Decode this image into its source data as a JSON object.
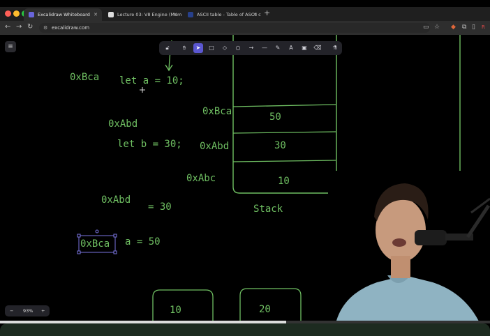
{
  "browser": {
    "tabs": [
      {
        "label": "Excalidraw Whiteboard",
        "active": true
      },
      {
        "label": "Lecture 03: V8 Engine (Mem",
        "active": false
      },
      {
        "label": "ASCII table - Table of ASCII c",
        "active": false
      }
    ],
    "url": "excalidraw.com",
    "profile_initial": "R"
  },
  "canvas": {
    "notes": {
      "addr_bca_top": "0xBca",
      "let_a": "let a = 10;",
      "addr_abd_1": "0xAbd",
      "let_b": "let b = 30;",
      "addr_abd_2": "0xAbd",
      "eq_30": "= 30",
      "addr_bca_selected": "0xBca",
      "a_eq_50": "a = 50"
    },
    "stack": {
      "label": "Stack",
      "cells": [
        {
          "addr": "0xBca",
          "value": "50"
        },
        {
          "addr": "0xAbd",
          "value": "30"
        },
        {
          "addr": "0xAbc",
          "value": "10"
        }
      ]
    },
    "bottom_boxes": [
      "10",
      "20"
    ]
  },
  "zoom": {
    "minus": "−",
    "value": "93%",
    "plus": "+"
  },
  "colors": {
    "ink": "#6fbf62",
    "selection": "#7a75e0",
    "toolbar_active": "#5b57d1"
  }
}
